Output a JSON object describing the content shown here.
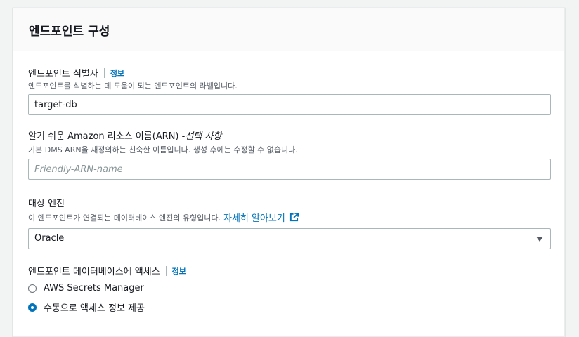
{
  "section": {
    "title": "엔드포인트 구성"
  },
  "endpoint_id": {
    "label": "엔드포인트 식별자",
    "info": "정보",
    "description": "엔드포인트를 식별하는 데 도움이 되는 엔드포인트의 라벨입니다.",
    "value": "target-db"
  },
  "arn": {
    "label": "알기 쉬운 Amazon 리소스 이름(ARN) - ",
    "optional": "선택 사항",
    "description": "기본 DMS ARN을 재정의하는 친숙한 이름입니다. 생성 후에는 수정할 수 없습니다.",
    "placeholder": "Friendly-ARN-name"
  },
  "engine": {
    "label": "대상 엔진",
    "description": "이 엔드포인트가 연결되는 데이터베이스 엔진의 유형입니다.",
    "learn_more": "자세히 알아보기",
    "selected": "Oracle"
  },
  "access": {
    "label": "엔드포인트 데이터베이스에 액세스",
    "info": "정보",
    "options": [
      {
        "label": "AWS Secrets Manager",
        "selected": false
      },
      {
        "label": "수동으로 액세스 정보 제공",
        "selected": true
      }
    ]
  },
  "colors": {
    "link": "#0073bb",
    "radio_selected": "#0073bb"
  },
  "icons": {
    "external_link": "external-link-icon",
    "dropdown": "caret-down-icon"
  }
}
